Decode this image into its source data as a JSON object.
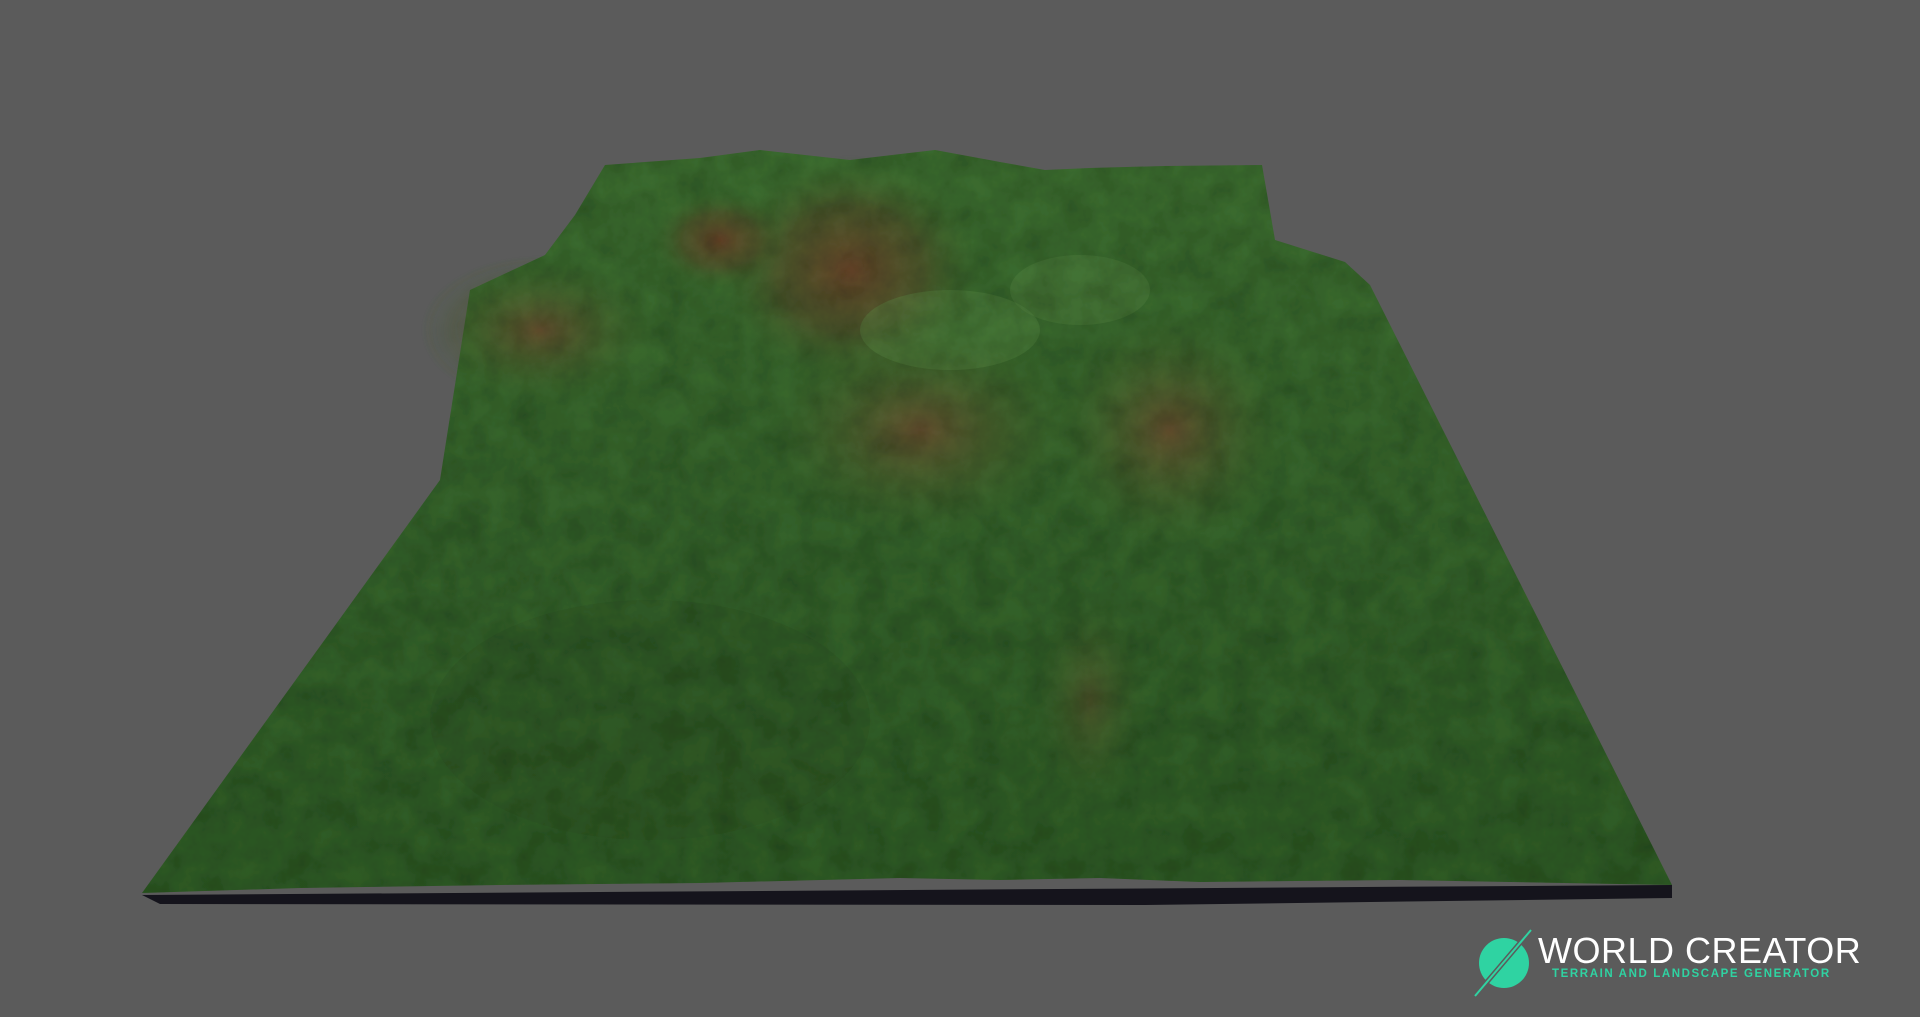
{
  "viewport": {
    "background_color": "#5b5b5b",
    "scene": "terrain-render",
    "terrain_colors": {
      "grass": "#3d6a2b",
      "grass_dark": "#2a4d1f",
      "rock": "#6b4a2e",
      "base": "#15141c"
    }
  },
  "brand": {
    "title": "WORLD CREATOR",
    "subtitle": "TERRAIN AND LANDSCAPE GENERATOR",
    "icon": "world-creator-logo-icon",
    "accent_color": "#2fd3a2",
    "title_color": "#ffffff"
  }
}
